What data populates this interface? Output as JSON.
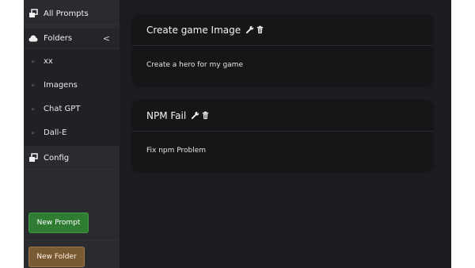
{
  "sidebar": {
    "all_prompts": "All Prompts",
    "folders": "Folders",
    "folders_chevron": "<",
    "folder_items": [
      "xx",
      "Imagens",
      "Chat GPT",
      "Dall-E"
    ],
    "config": "Config"
  },
  "buttons": {
    "new_prompt": "New Prompt",
    "new_folder": "New Folder"
  },
  "prompts": [
    {
      "title": "Create game Image",
      "description": "Create a hero for my game"
    },
    {
      "title": "NPM Fail",
      "description": "Fix npm Problem"
    }
  ],
  "icons": {
    "prompts_icon": "copy-icon",
    "folders_icon": "cloud-icon",
    "config_icon": "copy-icon",
    "edit_icon": "wrench-icon",
    "delete_icon": "trash-icon",
    "folder_arrow": "chevron-right-icon"
  },
  "colors": {
    "new_prompt_button": "#2f7d33",
    "new_folder_button": "#7a5a34",
    "card_background": "#151618",
    "app_background": "#1c1d20"
  }
}
